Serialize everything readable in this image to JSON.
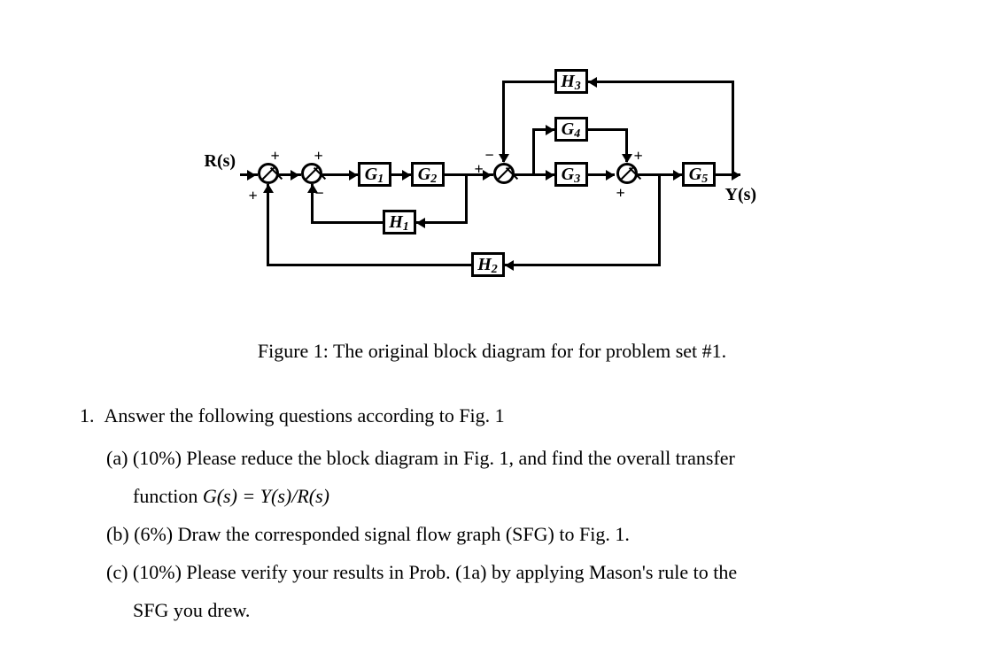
{
  "diagram": {
    "input_label": "R(s)",
    "output_label": "Y(s)",
    "blocks": {
      "G1": "G",
      "G1_sub": "1",
      "G2": "G",
      "G2_sub": "2",
      "G3": "G",
      "G3_sub": "3",
      "G4": "G",
      "G4_sub": "4",
      "G5": "G",
      "G5_sub": "5",
      "H1": "H",
      "H1_sub": "1",
      "H2": "H",
      "H2_sub": "2",
      "H3": "H",
      "H3_sub": "3"
    },
    "signs": {
      "s1_top": "+",
      "s1_bot": "+",
      "s2_top": "+",
      "s2_bot": "−",
      "s3_top": "−",
      "s3_left": "+",
      "s4_right": "+",
      "s4_bot": "+"
    }
  },
  "caption": "Figure 1: The original block diagram for for problem set #1.",
  "q1_intro_num": "1.",
  "q1_intro_text": "Answer the following questions according to Fig. 1",
  "q1a_label": "(a)",
  "q1a_pct": "(10%)",
  "q1a_text1": "Please reduce the block diagram in Fig. 1, and find the overall transfer",
  "q1a_text2_prefix": "function ",
  "q1a_math": "G(s) = Y(s)/R(s)",
  "q1b_label": "(b)",
  "q1b_pct": "(6%)",
  "q1b_text": "Draw the corresponded signal flow graph (SFG) to Fig. 1.",
  "q1c_label": "(c)",
  "q1c_pct": "(10%)",
  "q1c_text1": "Please verify your results in Prob. (1a) by applying Mason's rule to the",
  "q1c_text2": "SFG you drew."
}
